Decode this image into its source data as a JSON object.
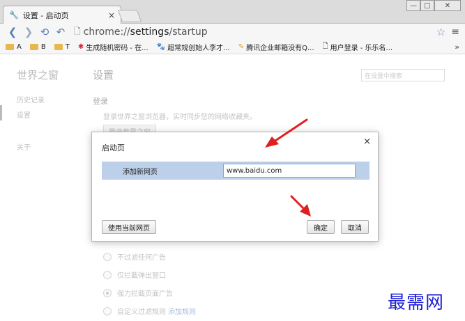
{
  "browser": {
    "tab_title": "设置 - 启动页",
    "url_prefix": "chrome://",
    "url_host": "settings",
    "url_path": "/startup",
    "tab_close": "×",
    "win_minimize": "—",
    "win_maximize": "□",
    "win_close": "✕",
    "bookmarks": [
      {
        "label": "A",
        "type": "folder"
      },
      {
        "label": "B",
        "type": "folder"
      },
      {
        "label": "T",
        "type": "folder"
      },
      {
        "label": "生成随机密码 - 在...",
        "type": "site"
      },
      {
        "label": "超常规创始人李才...",
        "type": "site"
      },
      {
        "label": "腾讯企业邮箱没有Q...",
        "type": "site"
      },
      {
        "label": "用户登录 - 乐乐名...",
        "type": "site"
      }
    ],
    "bookmarks_more": "»"
  },
  "settings_page": {
    "brand": "世界之窗",
    "title": "设置",
    "search_placeholder": "在设置中搜索",
    "sidebar": [
      "历史记录",
      "设置",
      "关于"
    ],
    "section_title": "登录",
    "section_text": "登录世界之窗浏览器，实时同步您的网络收藏夹。",
    "section_button": "登录世界之窗",
    "radio_options": [
      {
        "label": "不过滤任何广告",
        "checked": false
      },
      {
        "label": "仅拦截弹出窗口",
        "checked": false
      },
      {
        "label": "强力拦截页面广告",
        "checked": true
      },
      {
        "label": "自定义过滤规则",
        "checked": false,
        "link": "添加规则"
      }
    ]
  },
  "dialog": {
    "title": "启动页",
    "close": "×",
    "row_label": "添加新网页",
    "row_input_value": "www.baidu.com",
    "use_current_button": "使用当前网页",
    "ok_button": "确定",
    "cancel_button": "取消"
  },
  "watermark": "最需网",
  "colors": {
    "dialog_row_bg": "#bdd0ea",
    "arrow": "#e02020",
    "watermark": "#2020d8"
  }
}
